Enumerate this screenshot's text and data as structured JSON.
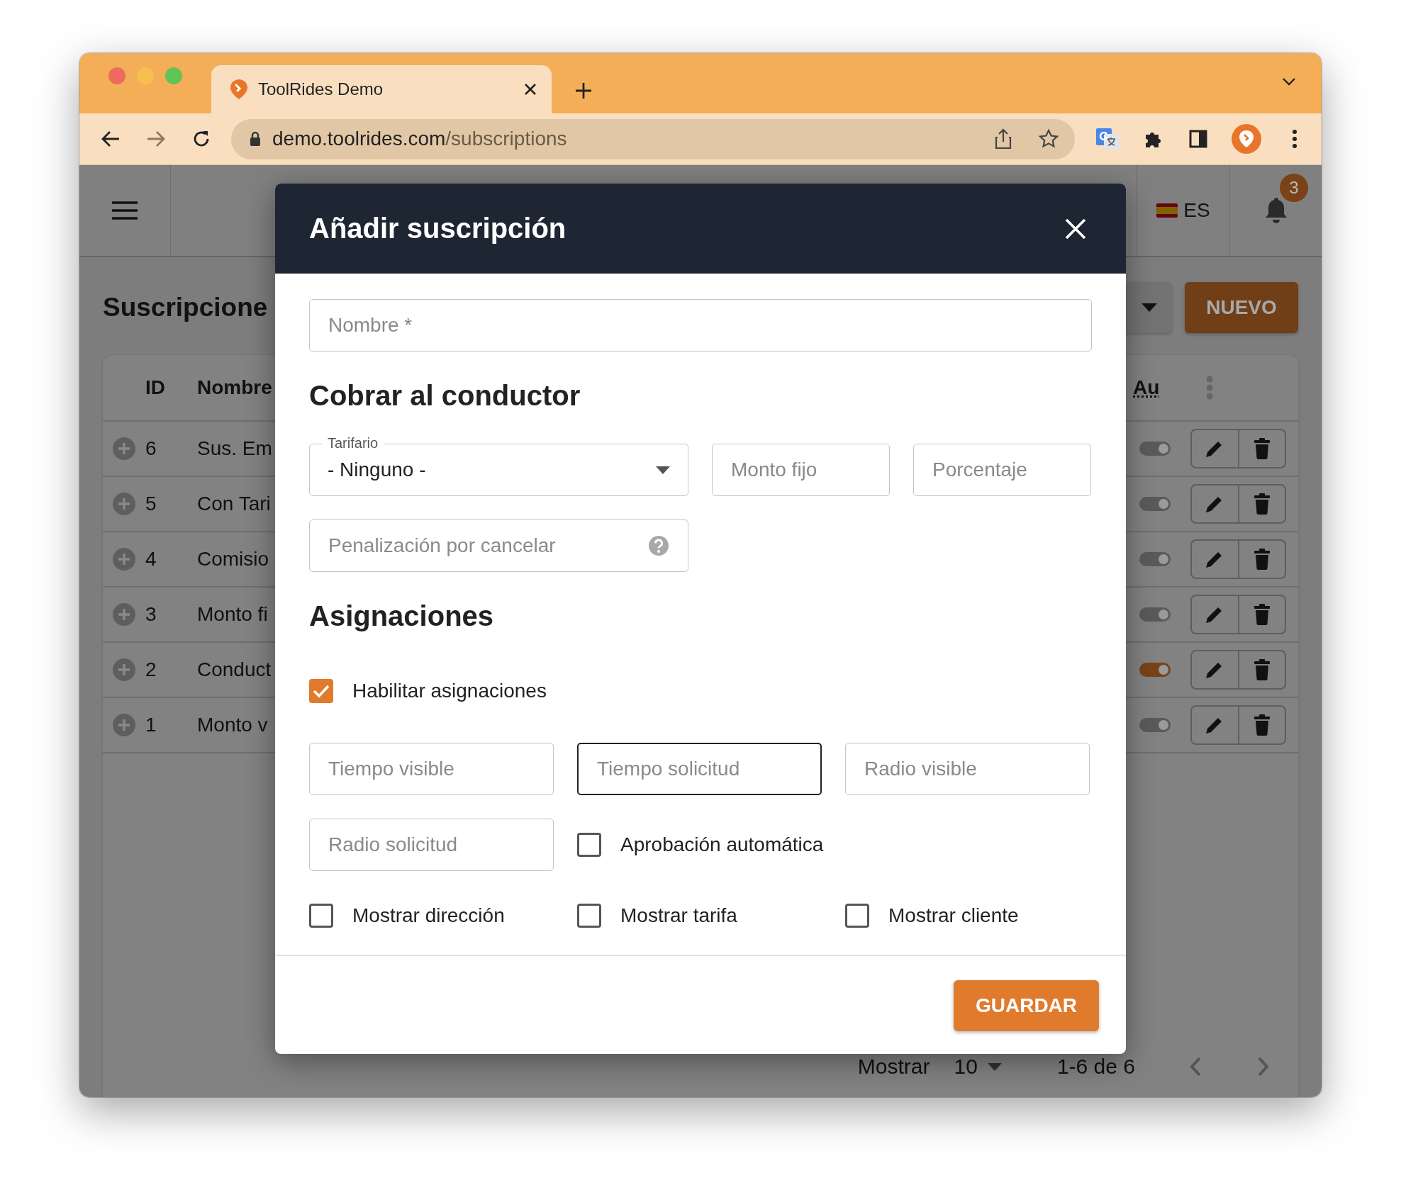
{
  "browser": {
    "tab_title": "ToolRides Demo",
    "url_host": "demo.toolrides.com",
    "url_path": "/subscriptions"
  },
  "app_header": {
    "language": "ES",
    "notification_count": "3"
  },
  "page": {
    "title": "Suscripcione",
    "new_button": "NUEVO"
  },
  "table": {
    "columns": [
      "ID",
      "Nombre",
      "Au"
    ],
    "rows": [
      {
        "id": "6",
        "name": "Sus. Em",
        "on": true,
        "disabled": true
      },
      {
        "id": "5",
        "name": "Con Tari",
        "on": true,
        "disabled": true
      },
      {
        "id": "4",
        "name": "Comisio",
        "on": true,
        "disabled": true
      },
      {
        "id": "3",
        "name": "Monto fi",
        "on": true,
        "disabled": true
      },
      {
        "id": "2",
        "name": "Conduct",
        "on": true,
        "disabled": false
      },
      {
        "id": "1",
        "name": "Monto v",
        "on": true,
        "disabled": true
      }
    ]
  },
  "pagination": {
    "label": "Mostrar",
    "page_size": "10",
    "range": "1-6 de 6"
  },
  "modal": {
    "title": "Añadir suscripción",
    "name_field": {
      "placeholder": "Nombre *"
    },
    "charge_heading": "Cobrar al conductor",
    "tariff_select": {
      "label": "Tarifario",
      "value": "- Ninguno -"
    },
    "fixed_amount": {
      "placeholder": "Monto fijo"
    },
    "percentage": {
      "placeholder": "Porcentaje"
    },
    "cancel_penalty": {
      "placeholder": "Penalización por cancelar"
    },
    "assign_heading": "Asignaciones",
    "enable_assignments": {
      "label": "Habilitar asignaciones",
      "checked": true
    },
    "fields": [
      {
        "placeholder": "Tiempo visible",
        "focused": false
      },
      {
        "placeholder": "Tiempo solicitud",
        "focused": true
      },
      {
        "placeholder": "Radio visible",
        "focused": false
      },
      {
        "placeholder": "Radio solicitud",
        "focused": false
      }
    ],
    "auto_approval": {
      "label": "Aprobación automática",
      "checked": false
    },
    "show_options": [
      {
        "label": "Mostrar dirección",
        "checked": false
      },
      {
        "label": "Mostrar tarifa",
        "checked": false
      },
      {
        "label": "Mostrar cliente",
        "checked": false
      }
    ],
    "save_button": "GUARDAR"
  }
}
